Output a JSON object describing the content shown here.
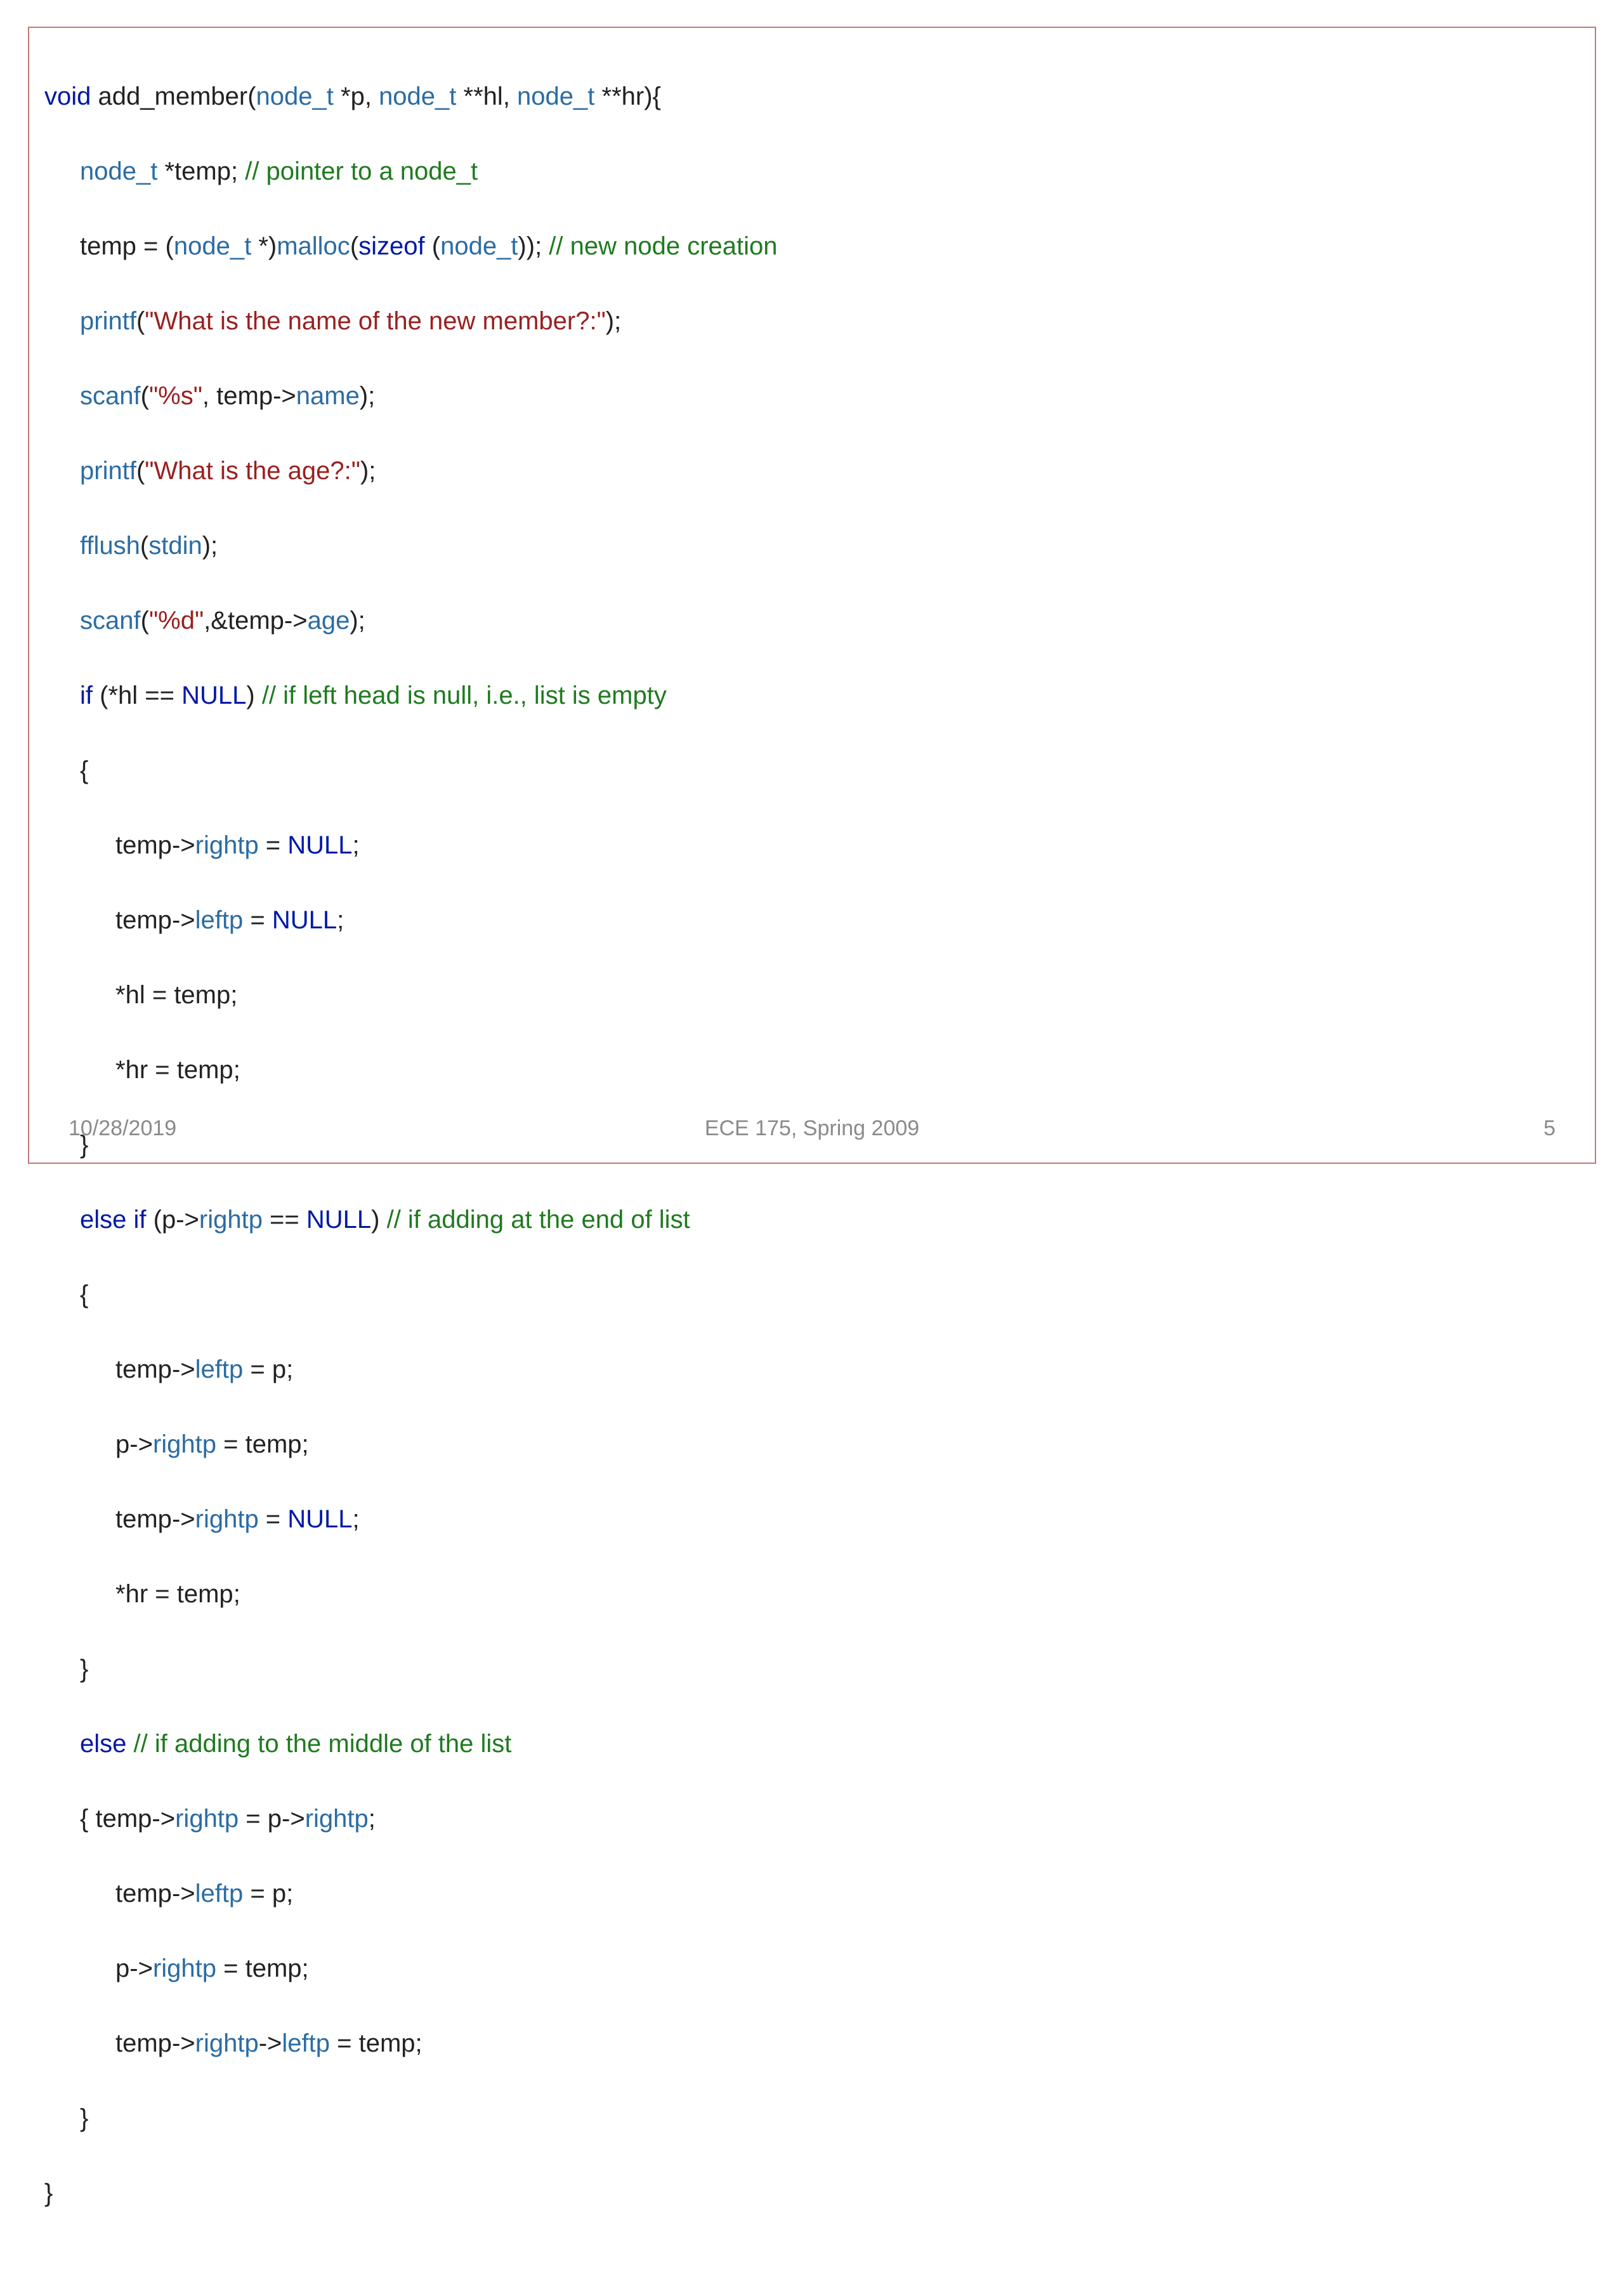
{
  "footer": {
    "date": "10/28/2019",
    "course": "ECE 175, Spring 2009",
    "page": "5"
  },
  "c": {
    "void": "void",
    "if": "if",
    "else": "else",
    "else_if": "else if",
    "sizeof": "sizeof",
    "NULL": "NULL",
    "node_t": "node_t",
    "printf": "printf",
    "scanf": "scanf",
    "fflush": "fflush",
    "malloc": "malloc",
    "stdin": "stdin",
    "name": "name",
    "age": "age",
    "rightp": "rightp",
    "leftp": "leftp",
    "fn": "add_member",
    "p": "p",
    "hl": "hl",
    "hr": "hr",
    "temp": "temp",
    "star": "*",
    "dstar": "**",
    "deref": "*",
    "s_what_name": "\"What is the name of the new member?:\"",
    "s_what_age": "\"What is the age?:\"",
    "s_pct_s": "\"%s\"",
    "s_pct_d": "\"%d\"",
    "cm_ptr": "// pointer to a node_t",
    "cm_newnode": "// new node creation",
    "cm_lefthead": "// if left head is null, i.e., list is empty",
    "cm_end": "// if adding at the end of list",
    "cm_middle": "// if adding to the middle of the list"
  }
}
